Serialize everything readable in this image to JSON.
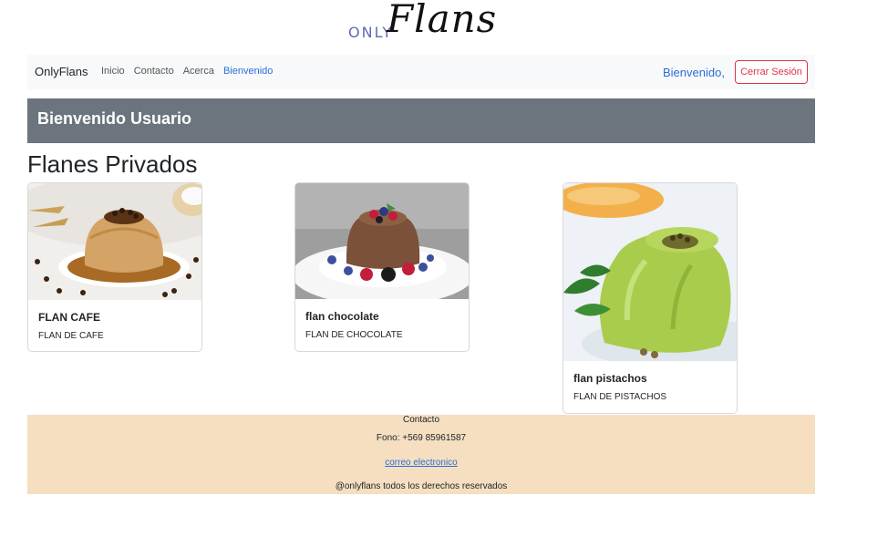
{
  "logo": {
    "small_text": "ONLY",
    "script_text": "Flans"
  },
  "navbar": {
    "brand": "OnlyFlans",
    "links": [
      "Inicio",
      "Contacto",
      "Acerca",
      "Bienvenido"
    ],
    "welcome": "Bienvenido,",
    "logout_label": "Cerrar Sesión"
  },
  "banner": {
    "title": "Bienvenido Usuario"
  },
  "section": {
    "title": "Flanes Privados"
  },
  "cards": [
    {
      "title": "FLAN CAFE",
      "description": "FLAN DE CAFE",
      "image": "coffee-flan-photo"
    },
    {
      "title": "flan chocolate",
      "description": "FLAN DE CHOCOLATE",
      "image": "chocolate-flan-photo"
    },
    {
      "title": "flan pistachos",
      "description": "FLAN DE PISTACHOS",
      "image": "pistachio-flan-photo"
    }
  ],
  "footer": {
    "title": "Contacto",
    "phone": "Fono: +569 85961587",
    "email_link": "correo electronico",
    "rights": "@onlyflans todos los derechos reservados"
  },
  "colors": {
    "navbar_bg": "#f8f9fa",
    "banner_bg": "#6c757d",
    "footer_bg": "#f5dfc0",
    "link_blue": "#2a6ed8",
    "logout_red": "#dc3545"
  }
}
